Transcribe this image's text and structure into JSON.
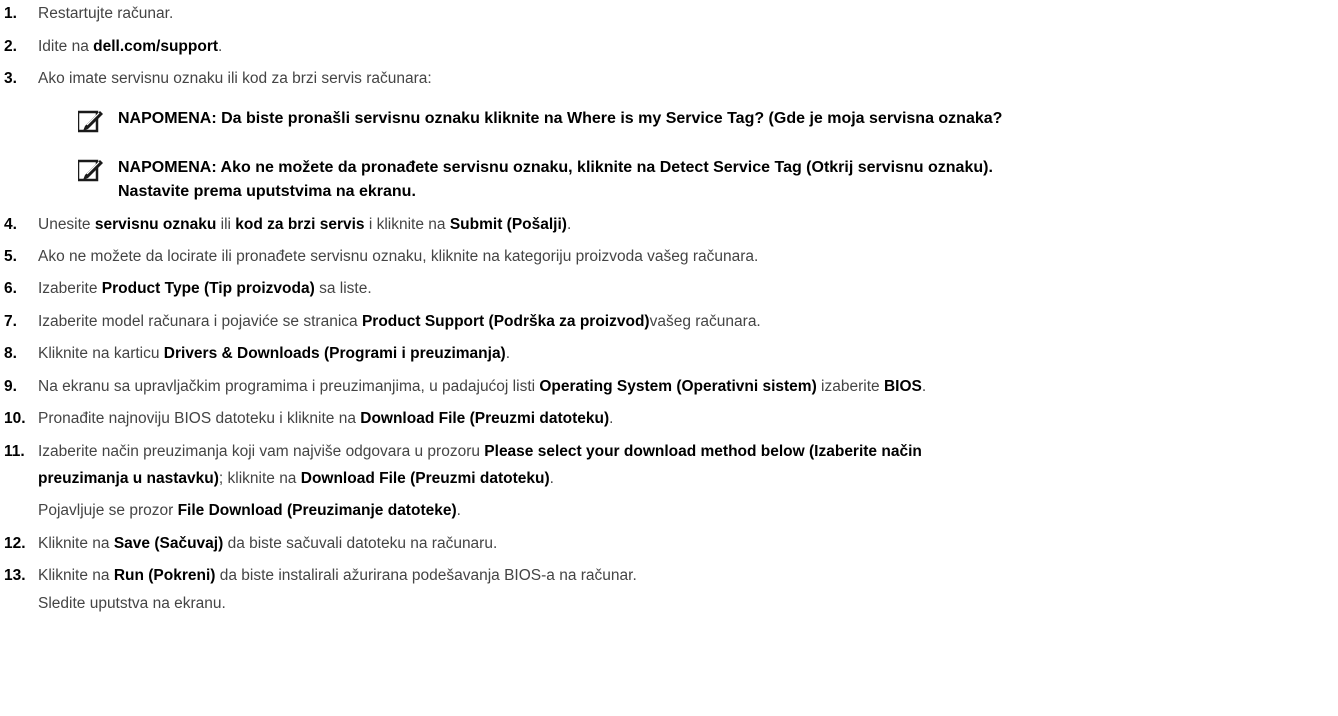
{
  "steps": [
    {
      "num": "1.",
      "segments": [
        {
          "t": "Restartujte računar.",
          "b": false
        }
      ]
    },
    {
      "num": "2.",
      "segments": [
        {
          "t": "Idite na ",
          "b": false
        },
        {
          "t": "dell.com/support",
          "b": true
        },
        {
          "t": ".",
          "b": false
        }
      ]
    },
    {
      "num": "3.",
      "segments": [
        {
          "t": "Ako imate servisnu oznaku ili kod za brzi servis računara:",
          "b": false
        }
      ]
    },
    {
      "num": "4.",
      "segments": [
        {
          "t": "Unesite ",
          "b": false
        },
        {
          "t": "servisnu oznaku",
          "b": true
        },
        {
          "t": " ili ",
          "b": false
        },
        {
          "t": "kod za brzi servis",
          "b": true
        },
        {
          "t": " i kliknite na ",
          "b": false
        },
        {
          "t": "Submit (Pošalji)",
          "b": true
        },
        {
          "t": ".",
          "b": false
        }
      ]
    },
    {
      "num": "5.",
      "segments": [
        {
          "t": "Ako ne možete da locirate ili pronađete servisnu oznaku, kliknite na kategoriju proizvoda vašeg računara.",
          "b": false
        }
      ]
    },
    {
      "num": "6.",
      "segments": [
        {
          "t": "Izaberite ",
          "b": false
        },
        {
          "t": "Product Type (Tip proizvoda)",
          "b": true
        },
        {
          "t": " sa liste.",
          "b": false
        }
      ]
    },
    {
      "num": "7.",
      "segments": [
        {
          "t": "Izaberite model računara i pojaviće se stranica ",
          "b": false
        },
        {
          "t": "Product Support (Podrška za proizvod)",
          "b": true
        },
        {
          "t": "vašeg računara.",
          "b": false
        }
      ]
    },
    {
      "num": "8.",
      "segments": [
        {
          "t": "Kliknite na karticu ",
          "b": false
        },
        {
          "t": "Drivers & Downloads (Programi i preuzimanja)",
          "b": true
        },
        {
          "t": ".",
          "b": false
        }
      ]
    },
    {
      "num": "9.",
      "segments": [
        {
          "t": "Na ekranu sa upravljačkim programima i preuzimanjima, u padajućoj listi ",
          "b": false
        },
        {
          "t": "Operating System (Operativni sistem)",
          "b": true
        },
        {
          "t": " izaberite ",
          "b": false
        },
        {
          "t": "BIOS",
          "b": true
        },
        {
          "t": ".",
          "b": false
        }
      ]
    },
    {
      "num": "10.",
      "segments": [
        {
          "t": "Pronađite najnoviju BIOS datoteku i kliknite na ",
          "b": false
        },
        {
          "t": "Download File (Preuzmi datoteku)",
          "b": true
        },
        {
          "t": ".",
          "b": false
        }
      ]
    },
    {
      "num": "11.",
      "segments": [
        {
          "t": "Izaberite način preuzimanja koji vam najviše odgovara u prozoru ",
          "b": false
        },
        {
          "t": "Please select your download method below (Izaberite način",
          "b": true
        }
      ]
    },
    {
      "num": "12.",
      "segments": [
        {
          "t": "Kliknite na ",
          "b": false
        },
        {
          "t": "Save (Sačuvaj)",
          "b": true
        },
        {
          "t": " da biste sačuvali datoteku na računaru.",
          "b": false
        }
      ]
    },
    {
      "num": "13.",
      "segments": [
        {
          "t": "Kliknite na ",
          "b": false
        },
        {
          "t": "Run (Pokreni)",
          "b": true
        },
        {
          "t": " da biste instalirali ažurirana podešavanja BIOS-a na računar.",
          "b": false
        }
      ]
    }
  ],
  "continuations": [
    {
      "after": "11.",
      "segments": [
        {
          "t": "preuzimanja u nastavku)",
          "b": true
        },
        {
          "t": "; kliknite na ",
          "b": false
        },
        {
          "t": "Download File (Preuzmi datoteku)",
          "b": true
        },
        {
          "t": ".",
          "b": false
        }
      ]
    },
    {
      "after": "11.",
      "segments": [
        {
          "t": "Pojavljuje se prozor ",
          "b": false
        },
        {
          "t": "File Download (Preuzimanje datoteke)",
          "b": true
        },
        {
          "t": ".",
          "b": false
        }
      ]
    },
    {
      "after": "13.",
      "segments": [
        {
          "t": "Sledite uputstva na ekranu.",
          "b": false
        }
      ]
    }
  ],
  "notes": [
    {
      "icon": "note-pencil-icon",
      "lines": [
        "NAPOMENA: Da biste pronašli servisnu oznaku kliknite na Where is my Service Tag? (Gde je moja servisna oznaka?"
      ]
    },
    {
      "icon": "note-pencil-icon",
      "lines": [
        "NAPOMENA: Ako ne možete da pronađete servisnu oznaku, kliknite na Detect Service Tag (Otkrij servisnu oznaku).",
        "Nastavite prema uputstvima na ekranu."
      ]
    }
  ]
}
